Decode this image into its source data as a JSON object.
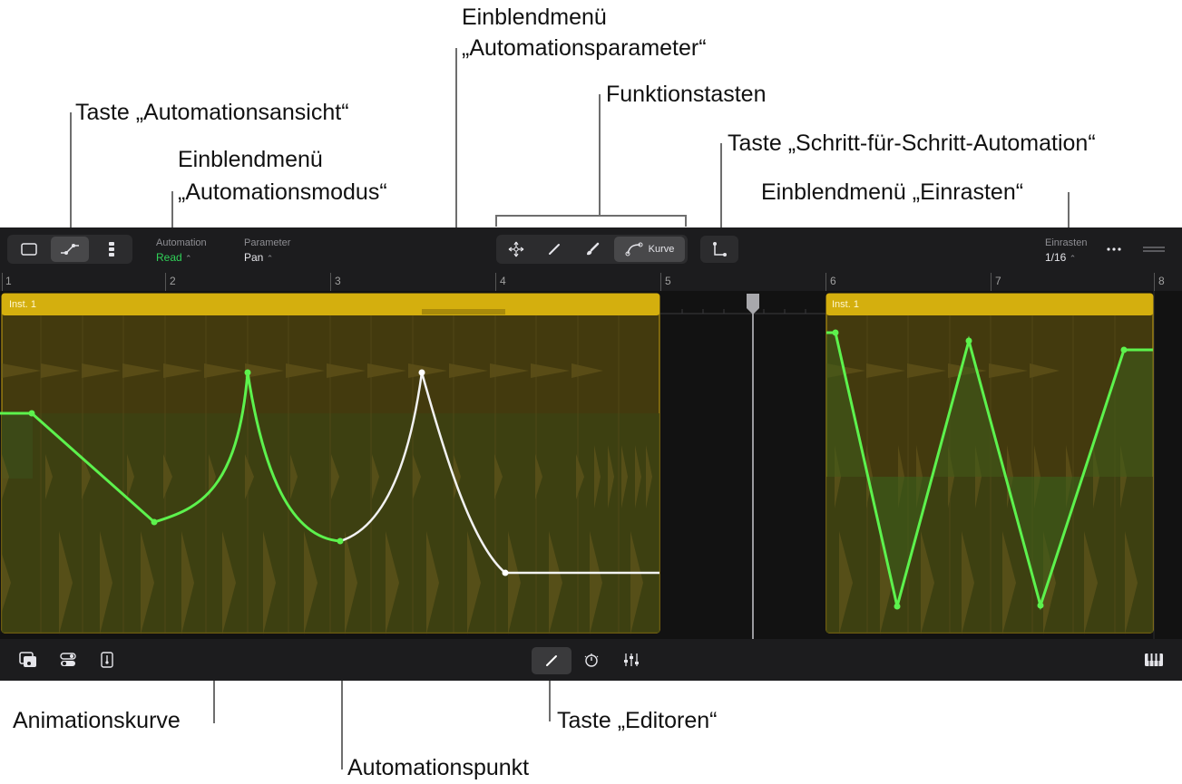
{
  "callouts": {
    "automation_view": "Taste „Automationsansicht“",
    "automation_mode_line1": "Einblendmenü",
    "automation_mode_line2": "„Automationsmodus“",
    "automation_param_line1": "Einblendmenü",
    "automation_param_line2": "„Automationsparameter“",
    "function_keys": "Funktionstasten",
    "step_automation": "Taste „Schritt-für-Schritt-Automation“",
    "snap_menu": "Einblendmenü „Einrasten“",
    "animation_curve": "Animationskurve",
    "automation_point": "Automationspunkt",
    "editors_button": "Taste „Editoren“"
  },
  "toolbar": {
    "automation_label": "Automation",
    "automation_value": "Read",
    "parameter_label": "Parameter",
    "parameter_value": "Pan",
    "curve_tool_label": "Kurve",
    "snap_label": "Einrasten",
    "snap_value": "1/16",
    "more_icon": "more-icon",
    "accent_green": "#30d158"
  },
  "ruler": {
    "bars": [
      "1",
      "2",
      "3",
      "4",
      "5",
      "6",
      "7",
      "8"
    ]
  },
  "regions": [
    {
      "name": "Inst. 1"
    },
    {
      "name": "Inst. 1"
    }
  ],
  "colors": {
    "region_header": "#d4af0e",
    "region_body": "#433a0e",
    "automation_curve": "#5df24d",
    "selected_curve": "#ffffff"
  }
}
